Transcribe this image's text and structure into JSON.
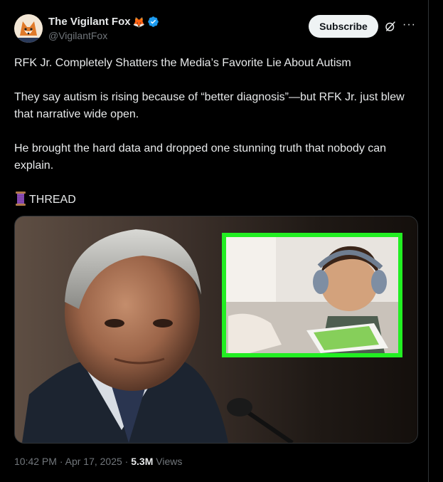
{
  "author": {
    "display_name": "The Vigilant Fox",
    "handle": "@VigilantFox",
    "badge_emoji": "🦊",
    "verified_icon": "verified-badge-icon"
  },
  "actions": {
    "subscribe_label": "Subscribe",
    "grok_icon": "grok-icon",
    "more_icon": "more-icon",
    "more_glyph": "···"
  },
  "post": {
    "paragraphs": [
      "RFK Jr. Completely Shatters the Media’s Favorite Lie About Autism",
      "They say autism is rising because of “better diagnosis”—but RFK Jr. just blew that narrative wide open.",
      "He brought the hard data and dropped one stunning truth that nobody can explain."
    ],
    "thread_label": "THREAD",
    "thread_icon": "spool-of-thread-icon"
  },
  "media": {
    "description_icon": "photo-image"
  },
  "meta": {
    "time": "10:42 PM",
    "separator": " · ",
    "date": "Apr 17, 2025",
    "views_count": "5.3M",
    "views_label": " Views"
  },
  "colors": {
    "background": "#000000",
    "text": "#e7e9ea",
    "secondary_text": "#71767b",
    "verified_blue": "#1d9bf0",
    "highlight_green": "#22ee22"
  }
}
